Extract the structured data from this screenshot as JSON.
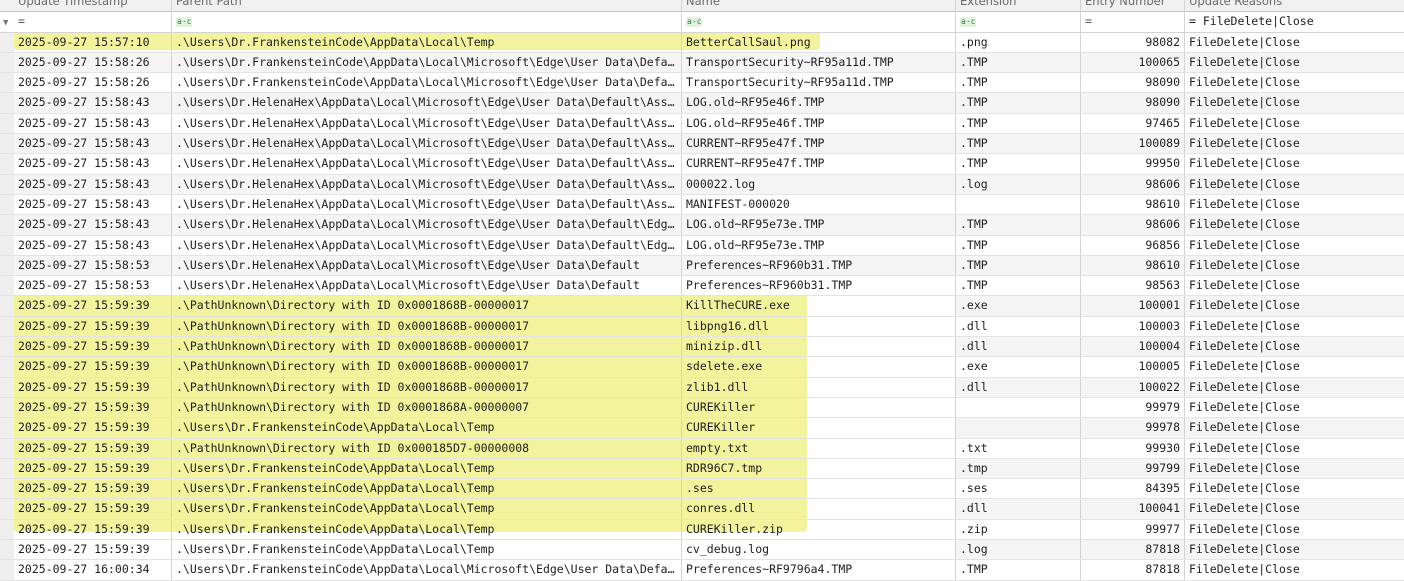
{
  "columns": [
    "Update Timestamp",
    "Parent Path",
    "Name",
    "Extension",
    "Entry Number",
    "Update Reasons"
  ],
  "filters": {
    "timestamp": "=",
    "parent_path": "a·c",
    "name": "a·c",
    "extension": "a·c",
    "entry_number": "=",
    "update_reasons": "= FileDelete|Close"
  },
  "rows": [
    {
      "ts": "2025-09-27 15:57:10",
      "path": ".\\Users\\Dr.FrankensteinCode\\AppData\\Local\\Temp",
      "name": "BetterCallSaul.png",
      "ext": ".png",
      "entry": "98082",
      "reason": "FileDelete|Close",
      "hl": true
    },
    {
      "ts": "2025-09-27 15:58:26",
      "path": ".\\Users\\Dr.FrankensteinCode\\AppData\\Local\\Microsoft\\Edge\\User Data\\Defa…",
      "name": "TransportSecurity~RF95a11d.TMP",
      "ext": ".TMP",
      "entry": "100065",
      "reason": "FileDelete|Close",
      "hl": false
    },
    {
      "ts": "2025-09-27 15:58:26",
      "path": ".\\Users\\Dr.FrankensteinCode\\AppData\\Local\\Microsoft\\Edge\\User Data\\Defa…",
      "name": "TransportSecurity~RF95a11d.TMP",
      "ext": ".TMP",
      "entry": "98090",
      "reason": "FileDelete|Close",
      "hl": false
    },
    {
      "ts": "2025-09-27 15:58:43",
      "path": ".\\Users\\Dr.HelenaHex\\AppData\\Local\\Microsoft\\Edge\\User Data\\Default\\Ass…",
      "name": "LOG.old~RF95e46f.TMP",
      "ext": ".TMP",
      "entry": "98090",
      "reason": "FileDelete|Close",
      "hl": false
    },
    {
      "ts": "2025-09-27 15:58:43",
      "path": ".\\Users\\Dr.HelenaHex\\AppData\\Local\\Microsoft\\Edge\\User Data\\Default\\Ass…",
      "name": "LOG.old~RF95e46f.TMP",
      "ext": ".TMP",
      "entry": "97465",
      "reason": "FileDelete|Close",
      "hl": false
    },
    {
      "ts": "2025-09-27 15:58:43",
      "path": ".\\Users\\Dr.HelenaHex\\AppData\\Local\\Microsoft\\Edge\\User Data\\Default\\Ass…",
      "name": "CURRENT~RF95e47f.TMP",
      "ext": ".TMP",
      "entry": "100089",
      "reason": "FileDelete|Close",
      "hl": false
    },
    {
      "ts": "2025-09-27 15:58:43",
      "path": ".\\Users\\Dr.HelenaHex\\AppData\\Local\\Microsoft\\Edge\\User Data\\Default\\Ass…",
      "name": "CURRENT~RF95e47f.TMP",
      "ext": ".TMP",
      "entry": "99950",
      "reason": "FileDelete|Close",
      "hl": false
    },
    {
      "ts": "2025-09-27 15:58:43",
      "path": ".\\Users\\Dr.HelenaHex\\AppData\\Local\\Microsoft\\Edge\\User Data\\Default\\Ass…",
      "name": "000022.log",
      "ext": ".log",
      "entry": "98606",
      "reason": "FileDelete|Close",
      "hl": false
    },
    {
      "ts": "2025-09-27 15:58:43",
      "path": ".\\Users\\Dr.HelenaHex\\AppData\\Local\\Microsoft\\Edge\\User Data\\Default\\Ass…",
      "name": "MANIFEST-000020",
      "ext": "",
      "entry": "98610",
      "reason": "FileDelete|Close",
      "hl": false
    },
    {
      "ts": "2025-09-27 15:58:43",
      "path": ".\\Users\\Dr.HelenaHex\\AppData\\Local\\Microsoft\\Edge\\User Data\\Default\\Edg…",
      "name": "LOG.old~RF95e73e.TMP",
      "ext": ".TMP",
      "entry": "98606",
      "reason": "FileDelete|Close",
      "hl": false
    },
    {
      "ts": "2025-09-27 15:58:43",
      "path": ".\\Users\\Dr.HelenaHex\\AppData\\Local\\Microsoft\\Edge\\User Data\\Default\\Edg…",
      "name": "LOG.old~RF95e73e.TMP",
      "ext": ".TMP",
      "entry": "96856",
      "reason": "FileDelete|Close",
      "hl": false
    },
    {
      "ts": "2025-09-27 15:58:53",
      "path": ".\\Users\\Dr.HelenaHex\\AppData\\Local\\Microsoft\\Edge\\User Data\\Default",
      "name": "Preferences~RF960b31.TMP",
      "ext": ".TMP",
      "entry": "98610",
      "reason": "FileDelete|Close",
      "hl": false
    },
    {
      "ts": "2025-09-27 15:58:53",
      "path": ".\\Users\\Dr.HelenaHex\\AppData\\Local\\Microsoft\\Edge\\User Data\\Default",
      "name": "Preferences~RF960b31.TMP",
      "ext": ".TMP",
      "entry": "98563",
      "reason": "FileDelete|Close",
      "hl": false
    },
    {
      "ts": "2025-09-27 15:59:39",
      "path": ".\\PathUnknown\\Directory with ID 0x0001868B-00000017",
      "name": "KillTheCURE.exe",
      "ext": ".exe",
      "entry": "100001",
      "reason": "FileDelete|Close",
      "hl": true
    },
    {
      "ts": "2025-09-27 15:59:39",
      "path": ".\\PathUnknown\\Directory with ID 0x0001868B-00000017",
      "name": "libpng16.dll",
      "ext": ".dll",
      "entry": "100003",
      "reason": "FileDelete|Close",
      "hl": true
    },
    {
      "ts": "2025-09-27 15:59:39",
      "path": ".\\PathUnknown\\Directory with ID 0x0001868B-00000017",
      "name": "minizip.dll",
      "ext": ".dll",
      "entry": "100004",
      "reason": "FileDelete|Close",
      "hl": true
    },
    {
      "ts": "2025-09-27 15:59:39",
      "path": ".\\PathUnknown\\Directory with ID 0x0001868B-00000017",
      "name": "sdelete.exe",
      "ext": ".exe",
      "entry": "100005",
      "reason": "FileDelete|Close",
      "hl": true
    },
    {
      "ts": "2025-09-27 15:59:39",
      "path": ".\\PathUnknown\\Directory with ID 0x0001868B-00000017",
      "name": "zlib1.dll",
      "ext": ".dll",
      "entry": "100022",
      "reason": "FileDelete|Close",
      "hl": true
    },
    {
      "ts": "2025-09-27 15:59:39",
      "path": ".\\PathUnknown\\Directory with ID 0x0001868A-00000007",
      "name": "CUREKiller",
      "ext": "",
      "entry": "99979",
      "reason": "FileDelete|Close",
      "hl": true
    },
    {
      "ts": "2025-09-27 15:59:39",
      "path": ".\\Users\\Dr.FrankensteinCode\\AppData\\Local\\Temp",
      "name": "CUREKiller",
      "ext": "",
      "entry": "99978",
      "reason": "FileDelete|Close",
      "hl": true
    },
    {
      "ts": "2025-09-27 15:59:39",
      "path": ".\\PathUnknown\\Directory with ID 0x000185D7-00000008",
      "name": "empty.txt",
      "ext": ".txt",
      "entry": "99930",
      "reason": "FileDelete|Close",
      "hl": true
    },
    {
      "ts": "2025-09-27 15:59:39",
      "path": ".\\Users\\Dr.FrankensteinCode\\AppData\\Local\\Temp",
      "name": "RDR96C7.tmp",
      "ext": ".tmp",
      "entry": "99799",
      "reason": "FileDelete|Close",
      "hl": true
    },
    {
      "ts": "2025-09-27 15:59:39",
      "path": ".\\Users\\Dr.FrankensteinCode\\AppData\\Local\\Temp",
      "name": ".ses",
      "ext": ".ses",
      "entry": "84395",
      "reason": "FileDelete|Close",
      "hl": true
    },
    {
      "ts": "2025-09-27 15:59:39",
      "path": ".\\Users\\Dr.FrankensteinCode\\AppData\\Local\\Temp",
      "name": "conres.dll",
      "ext": ".dll",
      "entry": "100041",
      "reason": "FileDelete|Close",
      "hl": true
    },
    {
      "ts": "2025-09-27 15:59:39",
      "path": ".\\Users\\Dr.FrankensteinCode\\AppData\\Local\\Temp",
      "name": "CUREKiller.zip",
      "ext": ".zip",
      "entry": "99977",
      "reason": "FileDelete|Close",
      "hl": true
    },
    {
      "ts": "2025-09-27 15:59:39",
      "path": ".\\Users\\Dr.FrankensteinCode\\AppData\\Local\\Temp",
      "name": "cv_debug.log",
      "ext": ".log",
      "entry": "87818",
      "reason": "FileDelete|Close",
      "hl": true
    },
    {
      "ts": "2025-09-27 16:00:34",
      "path": ".\\Users\\Dr.FrankensteinCode\\AppData\\Local\\Microsoft\\Edge\\User Data\\Defa…",
      "name": "Preferences~RF9796a4.TMP",
      "ext": ".TMP",
      "entry": "87818",
      "reason": "FileDelete|Close",
      "hl": false
    }
  ],
  "colors": {
    "highlight": "#f2f39c",
    "header_bg": "#f0f0f0",
    "row_alt": "#f5f5f5"
  }
}
